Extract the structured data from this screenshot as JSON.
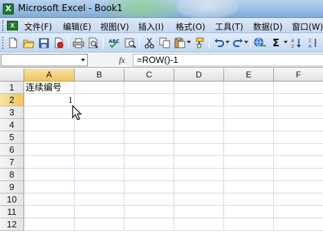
{
  "window": {
    "title": "Microsoft Excel - Book1",
    "app_icon": "X"
  },
  "menu": {
    "items": [
      {
        "label": "文件(F)"
      },
      {
        "label": "编辑(E)"
      },
      {
        "label": "视图(V)"
      },
      {
        "label": "插入(I)"
      },
      {
        "label": "格式(O)"
      },
      {
        "label": "工具(T)"
      },
      {
        "label": "数据(D)"
      },
      {
        "label": "窗口(W)"
      }
    ]
  },
  "toolbar": {
    "icons": [
      "new-icon",
      "open-icon",
      "save-icon",
      "permission-icon",
      "print-icon",
      "print-preview-icon",
      "spelling-icon",
      "research-icon",
      "cut-icon",
      "copy-icon",
      "paste-icon",
      "format-painter-icon",
      "undo-icon",
      "redo-icon",
      "hyperlink-icon",
      "autosum-icon",
      "sort-ascending-icon"
    ],
    "autosum_symbol": "Σ"
  },
  "formula_bar": {
    "name_box": "",
    "fx": "fx",
    "formula": "=ROW()-1"
  },
  "sheet": {
    "columns": [
      "A",
      "B",
      "C",
      "D",
      "E",
      "F"
    ],
    "rows": [
      "1",
      "2",
      "3",
      "4",
      "5",
      "6",
      "7",
      "8",
      "9",
      "10",
      "11",
      "12"
    ],
    "cells": {
      "A1": "连续编号",
      "A2": "1"
    },
    "active_column": "A",
    "active_row": "2"
  },
  "colors": {
    "title_bar": "#9fc1e8",
    "menu_bar": "#c6d8ef",
    "header_active": "#f1c45e",
    "gridline": "#d0d7e5"
  }
}
